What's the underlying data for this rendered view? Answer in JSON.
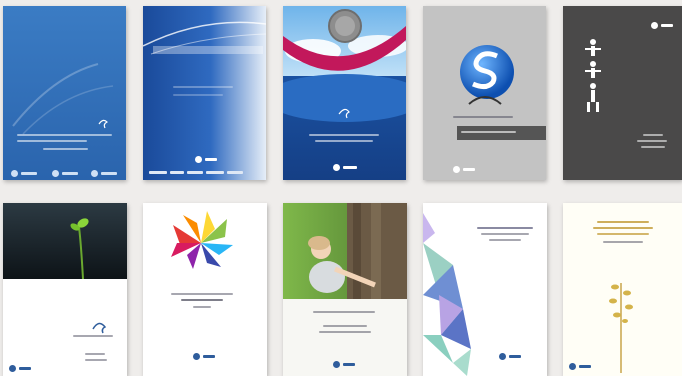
{
  "gallery": {
    "covers": [
      {
        "id": "cover-1",
        "theme": "blue-wave",
        "bg": "#2f6db8"
      },
      {
        "id": "cover-2",
        "theme": "blue-gradient-swoosh",
        "bg": "#1e4f9e"
      },
      {
        "id": "cover-3",
        "theme": "sky-pink-arc-globe",
        "bg": "#1a5fb0"
      },
      {
        "id": "cover-4",
        "theme": "grey-blue-s-logo",
        "bg": "#c3c3c3"
      },
      {
        "id": "cover-5",
        "theme": "dark-grey-figures",
        "bg": "#4a4949"
      },
      {
        "id": "cover-6",
        "theme": "dark-sprout",
        "bg": "#1e2326"
      },
      {
        "id": "cover-7",
        "theme": "white-color-fan",
        "bg": "#ffffff"
      },
      {
        "id": "cover-8",
        "theme": "forest-child-tree",
        "bg": "#f7f7f3"
      },
      {
        "id": "cover-9",
        "theme": "white-crystal-shards",
        "bg": "#ffffff"
      },
      {
        "id": "cover-10",
        "theme": "white-gold-plant",
        "bg": "#fffef6"
      }
    ]
  }
}
